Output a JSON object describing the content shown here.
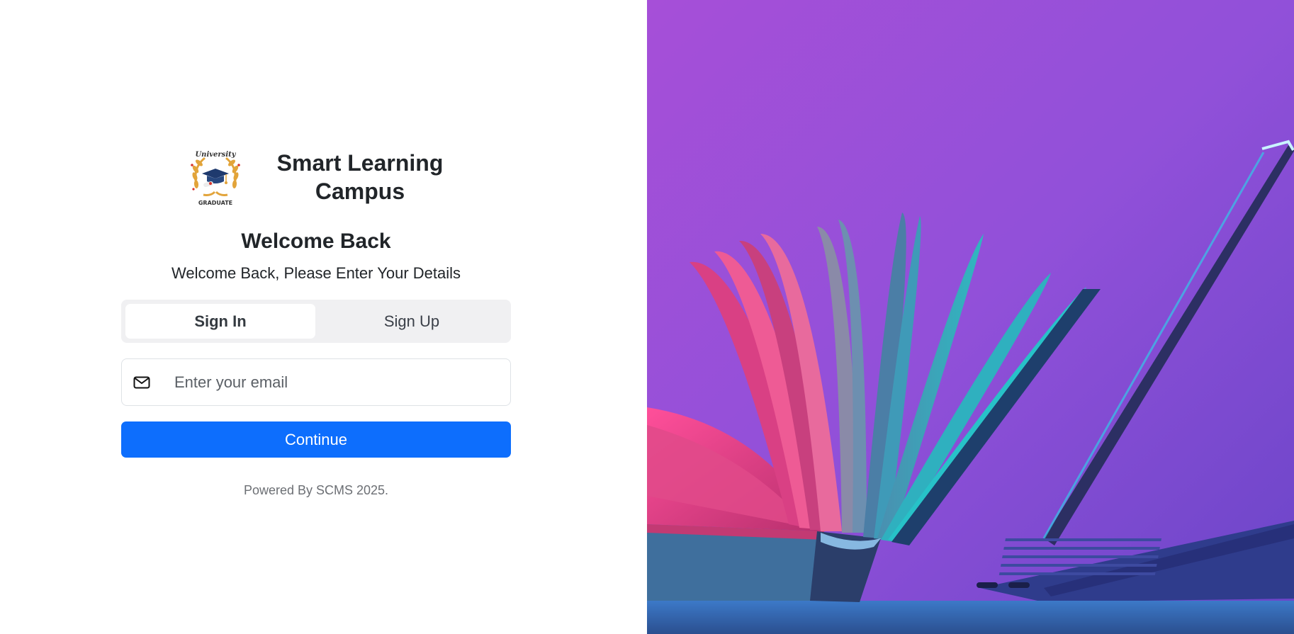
{
  "brand": {
    "title": "Smart Learning Campus",
    "logo_top_text": "University",
    "logo_bottom_text": "GRADUATE"
  },
  "heading": "Welcome Back",
  "subtitle": "Welcome Back, Please Enter Your Details",
  "tabs": [
    {
      "label": "Sign In",
      "active": true
    },
    {
      "label": "Sign Up",
      "active": false
    }
  ],
  "email": {
    "icon": "envelope-icon",
    "placeholder": "Enter your email",
    "value": ""
  },
  "continue_label": "Continue",
  "footer": "Powered By SCMS 2025.",
  "colors": {
    "primary": "#0d6efd",
    "tab_track": "#f0f0f2",
    "hero_purple": "#9b4fd9"
  }
}
